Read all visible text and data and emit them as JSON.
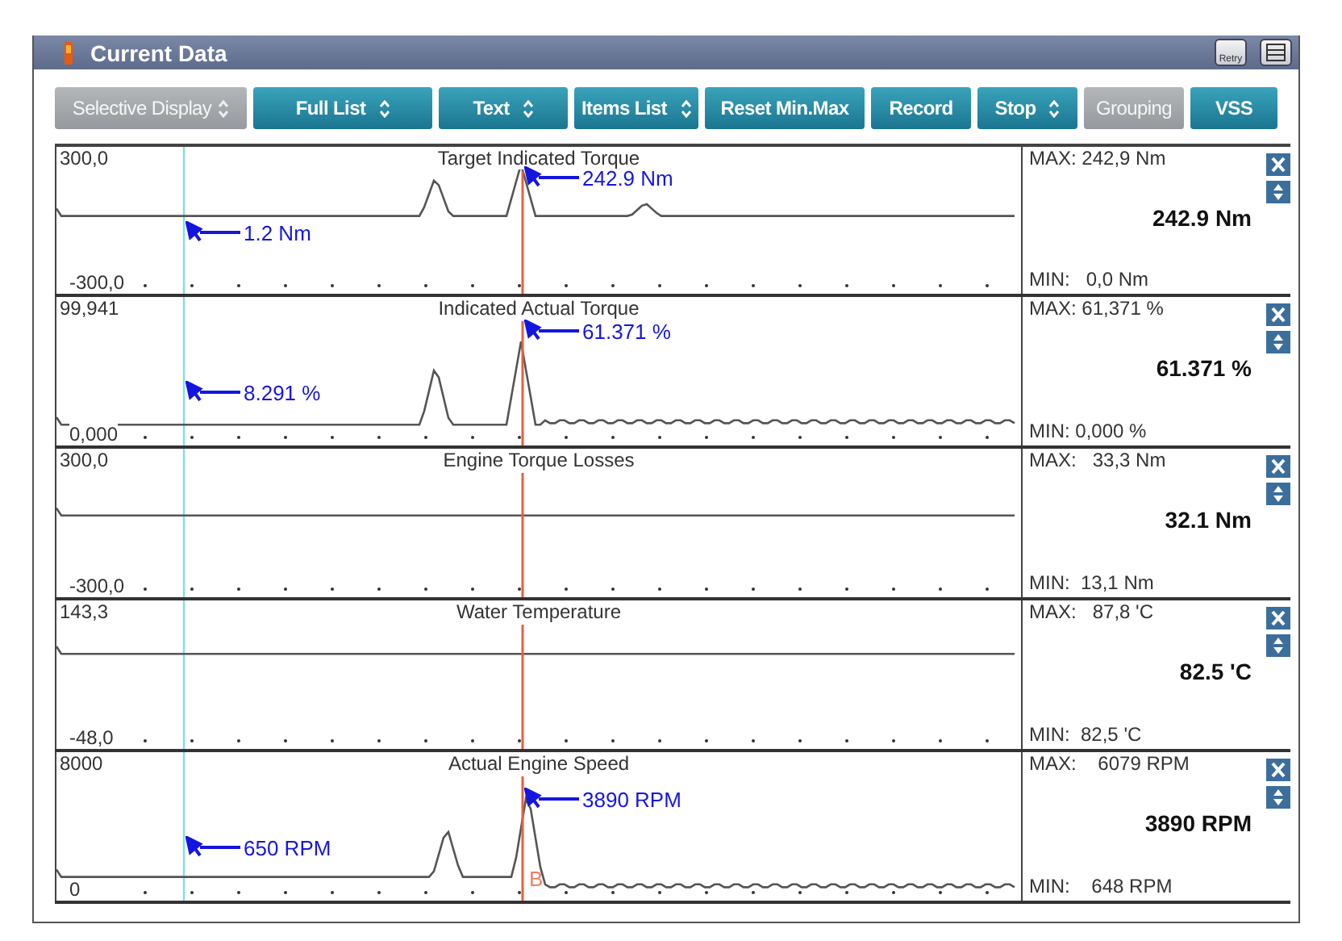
{
  "window": {
    "title": "Current Data",
    "retry_label": "Retry"
  },
  "toolbar": [
    {
      "label": "Selective Display",
      "dropdown": true,
      "disabled": true
    },
    {
      "label": "Full List",
      "dropdown": true,
      "disabled": false
    },
    {
      "label": "Text",
      "dropdown": true,
      "disabled": false
    },
    {
      "label": "Items List",
      "dropdown": true,
      "disabled": false
    },
    {
      "label": "Reset Min.Max",
      "dropdown": false,
      "disabled": false
    },
    {
      "label": "Record",
      "dropdown": false,
      "disabled": false
    },
    {
      "label": "Stop",
      "dropdown": true,
      "disabled": false
    },
    {
      "label": "Grouping",
      "dropdown": false,
      "disabled": true
    },
    {
      "label": "VSS",
      "dropdown": false,
      "disabled": false
    }
  ],
  "plots": [
    {
      "title": "Target Indicated Torque",
      "axis_max": "300,0",
      "axis_min": "-300,0",
      "max": "MAX: 242,9 Nm",
      "current": "242.9 Nm",
      "min": "MIN:   0,0 Nm",
      "cursor_a": "1.2 Nm",
      "cursor_b": "242.9 Nm"
    },
    {
      "title": "Indicated Actual Torque",
      "axis_max": "99,941",
      "axis_min": "0,000",
      "max": "MAX: 61,371 %",
      "current": "61.371 %",
      "min": "MIN: 0,000 %",
      "cursor_a": "8.291 %",
      "cursor_b": "61.371 %"
    },
    {
      "title": "Engine Torque Losses",
      "axis_max": "300,0",
      "axis_min": "-300,0",
      "max": "MAX:   33,3 Nm",
      "current": "32.1 Nm",
      "min": "MIN:  13,1 Nm"
    },
    {
      "title": "Water Temperature",
      "axis_max": "143,3",
      "axis_min": "-48,0",
      "max": "MAX:   87,8 'C",
      "current": "82.5 'C",
      "min": "MIN:  82,5 'C"
    },
    {
      "title": "Actual Engine Speed",
      "axis_max": "8000",
      "axis_min": "0",
      "max": "MAX:    6079 RPM",
      "current": "3890 RPM",
      "min": "MIN:    648 RPM",
      "cursor_a": "650 RPM",
      "cursor_b": "3890 RPM",
      "marker": "B"
    }
  ]
}
